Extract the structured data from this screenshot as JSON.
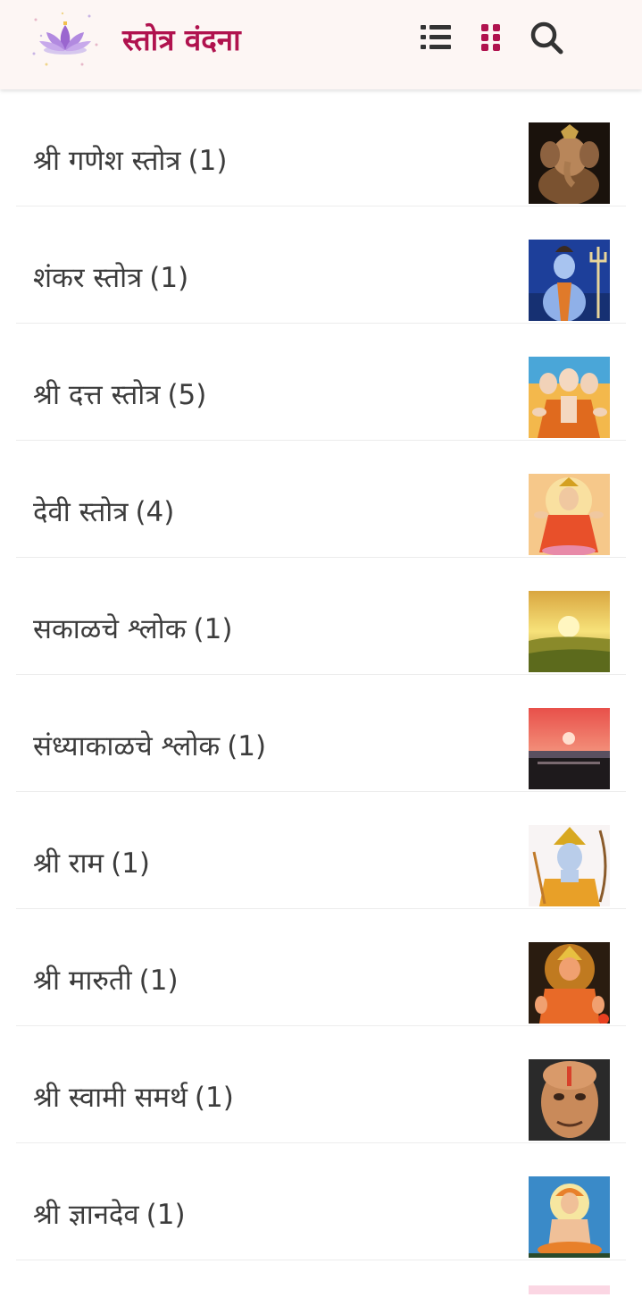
{
  "app_bar": {
    "title": "स्तोत्र वंदना",
    "logo_icon": "lotus-logo-icon",
    "actions": [
      {
        "icon": "list-view-icon",
        "color": "#333333"
      },
      {
        "icon": "grid-view-icon",
        "color": "#b0124e"
      },
      {
        "icon": "search-icon",
        "color": "#333333"
      }
    ]
  },
  "categories": [
    {
      "name": "श्री गणेश स्तोत्र",
      "count": "(1)",
      "thumbnail": "ganesh-image"
    },
    {
      "name": "शंकर स्तोत्र",
      "count": "(1)",
      "thumbnail": "shiva-image"
    },
    {
      "name": "श्री दत्त स्तोत्र",
      "count": "(5)",
      "thumbnail": "datta-image"
    },
    {
      "name": "देवी स्तोत्र",
      "count": "(4)",
      "thumbnail": "devi-image"
    },
    {
      "name": "सकाळचे श्लोक",
      "count": "(1)",
      "thumbnail": "sunrise-image"
    },
    {
      "name": "संध्याकाळचे श्लोक",
      "count": "(1)",
      "thumbnail": "sunset-image"
    },
    {
      "name": "श्री राम",
      "count": "(1)",
      "thumbnail": "ram-image"
    },
    {
      "name": "श्री मारुती",
      "count": "(1)",
      "thumbnail": "maruti-image"
    },
    {
      "name": "श्री स्वामी समर्थ",
      "count": "(1)",
      "thumbnail": "swami-samarth-image"
    },
    {
      "name": "श्री ज्ञानदेव",
      "count": "(1)",
      "thumbnail": "dnyandev-image"
    }
  ],
  "colors": {
    "accent": "#b0124e",
    "appbar_bg": "#fdf6f4",
    "text": "#3c3c3c"
  }
}
